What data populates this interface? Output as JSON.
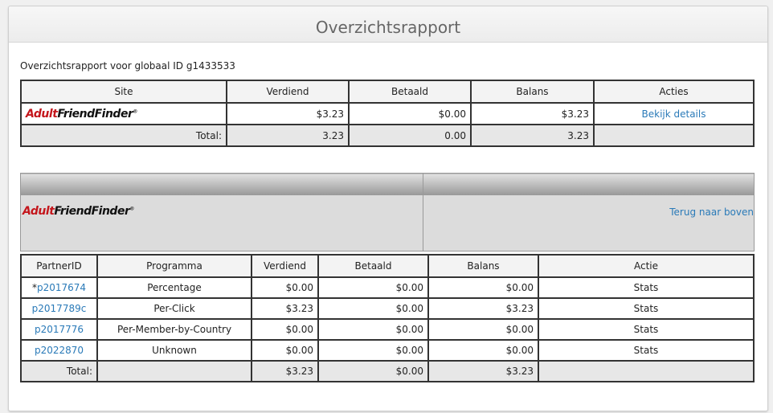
{
  "page": {
    "title": "Overzichtsrapport",
    "subtitle": "Overzichtsrapport voor globaal ID g1433533"
  },
  "summary": {
    "headers": [
      "Site",
      "Verdiend",
      "Betaald",
      "Balans",
      "Acties"
    ],
    "row": {
      "site_logo_red": "Adult",
      "site_logo_black": "FriendFinder",
      "verdiend": "$3.23",
      "betaald": "$0.00",
      "balans": "$3.23",
      "action": "Bekijk details"
    },
    "total": {
      "label": "Total:",
      "verdiend": "3.23",
      "betaald": "0.00",
      "balans": "3.23"
    }
  },
  "detail": {
    "site_logo_red": "Adult",
    "site_logo_black": "FriendFinder",
    "back_link": "Terug naar boven",
    "headers": [
      "PartnerID",
      "Programma",
      "Verdiend",
      "Betaald",
      "Balans",
      "Actie"
    ],
    "rows": [
      {
        "prefix": "*",
        "id": "p2017674",
        "program": "Percentage",
        "verdiend": "$0.00",
        "betaald": "$0.00",
        "balans": "$0.00",
        "action": "Stats"
      },
      {
        "prefix": "",
        "id": "p2017789c",
        "program": "Per-Click",
        "verdiend": "$3.23",
        "betaald": "$0.00",
        "balans": "$3.23",
        "action": "Stats"
      },
      {
        "prefix": "",
        "id": "p2017776",
        "program": "Per-Member-by-Country",
        "verdiend": "$0.00",
        "betaald": "$0.00",
        "balans": "$0.00",
        "action": "Stats"
      },
      {
        "prefix": "",
        "id": "p2022870",
        "program": "Unknown",
        "verdiend": "$0.00",
        "betaald": "$0.00",
        "balans": "$0.00",
        "action": "Stats"
      }
    ],
    "total": {
      "label": "Total:",
      "verdiend": "$3.23",
      "betaald": "$0.00",
      "balans": "$3.23"
    }
  }
}
